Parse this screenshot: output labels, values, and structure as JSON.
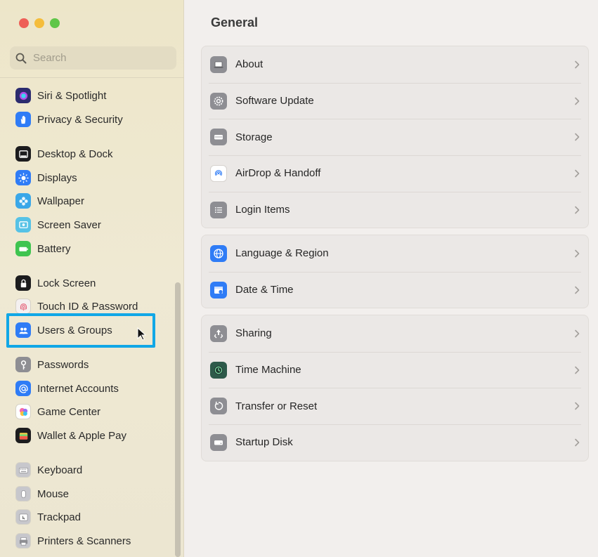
{
  "window": {
    "traffic_lights": [
      "close",
      "minimize",
      "zoom"
    ]
  },
  "search": {
    "placeholder": "Search",
    "value": ""
  },
  "sidebar": {
    "items": [
      {
        "label": "Siri & Spotlight",
        "icon": "siri-icon",
        "color": "#2b2b6e"
      },
      {
        "label": "Privacy & Security",
        "icon": "hand-icon",
        "color": "#2f7cf6"
      },
      {
        "label": "Desktop & Dock",
        "icon": "dock-icon",
        "color": "#1c1c1e"
      },
      {
        "label": "Displays",
        "icon": "sun-icon",
        "color": "#2f7cf6"
      },
      {
        "label": "Wallpaper",
        "icon": "flower-icon",
        "color": "#3aa7e8"
      },
      {
        "label": "Screen Saver",
        "icon": "screensaver-icon",
        "color": "#56c2e6"
      },
      {
        "label": "Battery",
        "icon": "battery-icon",
        "color": "#3fc450"
      },
      {
        "label": "Lock Screen",
        "icon": "lock-icon",
        "color": "#1c1c1e"
      },
      {
        "label": "Touch ID & Password",
        "icon": "fingerprint-icon",
        "color": "#f4f0f0"
      },
      {
        "label": "Users & Groups",
        "icon": "users-icon",
        "color": "#2f7cf6"
      },
      {
        "label": "Passwords",
        "icon": "key-icon",
        "color": "#8e8e93"
      },
      {
        "label": "Internet Accounts",
        "icon": "at-icon",
        "color": "#2f7cf6"
      },
      {
        "label": "Game Center",
        "icon": "gamecenter-icon",
        "color": "#ffffff"
      },
      {
        "label": "Wallet & Apple Pay",
        "icon": "wallet-icon",
        "color": "#1c1c1e"
      },
      {
        "label": "Keyboard",
        "icon": "keyboard-icon",
        "color": "#c7c7cc"
      },
      {
        "label": "Mouse",
        "icon": "mouse-icon",
        "color": "#c7c7cc"
      },
      {
        "label": "Trackpad",
        "icon": "trackpad-icon",
        "color": "#c7c7cc"
      },
      {
        "label": "Printers & Scanners",
        "icon": "printer-icon",
        "color": "#c7c7cc"
      }
    ],
    "highlighted": "Users & Groups"
  },
  "main": {
    "title": "General",
    "groups": [
      [
        {
          "label": "About",
          "icon": "laptop-icon",
          "color": "#8e8e93"
        },
        {
          "label": "Software Update",
          "icon": "gear-icon",
          "color": "#8e8e93"
        },
        {
          "label": "Storage",
          "icon": "storage-icon",
          "color": "#8e8e93"
        },
        {
          "label": "AirDrop & Handoff",
          "icon": "airdrop-icon",
          "color": "#ffffff"
        },
        {
          "label": "Login Items",
          "icon": "list-icon",
          "color": "#8e8e93"
        }
      ],
      [
        {
          "label": "Language & Region",
          "icon": "globe-icon",
          "color": "#2f7cf6"
        },
        {
          "label": "Date & Time",
          "icon": "calendar-icon",
          "color": "#2f7cf6"
        }
      ],
      [
        {
          "label": "Sharing",
          "icon": "sharing-icon",
          "color": "#8e8e93"
        },
        {
          "label": "Time Machine",
          "icon": "timemachine-icon",
          "color": "#2e5a4a"
        },
        {
          "label": "Transfer or Reset",
          "icon": "reset-icon",
          "color": "#8e8e93"
        },
        {
          "label": "Startup Disk",
          "icon": "disk-icon",
          "color": "#8e8e93"
        }
      ]
    ]
  }
}
